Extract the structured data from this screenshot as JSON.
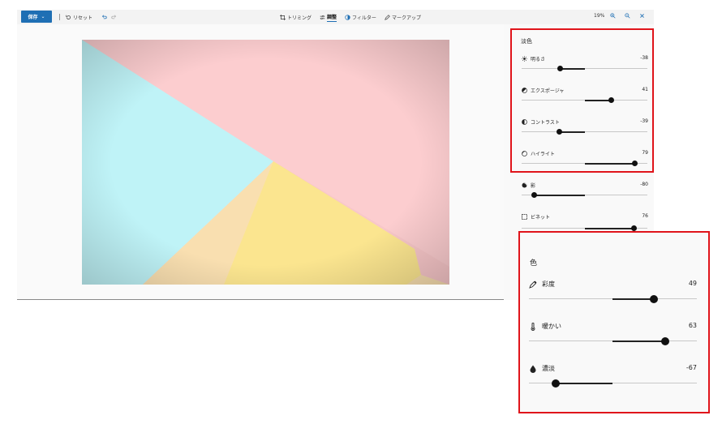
{
  "toolbar": {
    "save_label": "保存",
    "reset_label": "リセット",
    "tabs": [
      {
        "label": "トリミング"
      },
      {
        "label": "調整"
      },
      {
        "label": "フィルター"
      },
      {
        "label": "マークアップ"
      }
    ],
    "zoom_level": "19%"
  },
  "panel": {
    "light_title": "淡色",
    "light_items": [
      {
        "label": "明るさ",
        "value": "-38",
        "level": -38,
        "icon": "sun-icon"
      },
      {
        "label": "エクスポージャ",
        "value": "41",
        "level": 41,
        "icon": "exposure-icon"
      },
      {
        "label": "コントラスト",
        "value": "-39",
        "level": -39,
        "icon": "contrast-icon"
      },
      {
        "label": "ハイライト",
        "value": "79",
        "level": 79,
        "icon": "highlight-icon"
      },
      {
        "label": "影",
        "value": "-80",
        "level": -80,
        "icon": "shadow-icon"
      },
      {
        "label": "ビネット",
        "value": "76",
        "level": 76,
        "icon": "vignette-icon"
      }
    ]
  },
  "color_panel": {
    "title": "色",
    "items": [
      {
        "label": "彩度",
        "value": "49",
        "level": 49,
        "icon": "eyedropper-icon"
      },
      {
        "label": "暖かい",
        "value": "63",
        "level": 63,
        "icon": "thermometer-icon"
      },
      {
        "label": "濃淡",
        "value": "-67",
        "level": -67,
        "icon": "droplet-icon"
      }
    ]
  },
  "colors": {
    "accent": "#1f6fb4",
    "highlight_border": "#e0141b",
    "photo_pink": "#fccdcf",
    "photo_cyan": "#bff3f7",
    "photo_yellow": "#fbe58f"
  }
}
